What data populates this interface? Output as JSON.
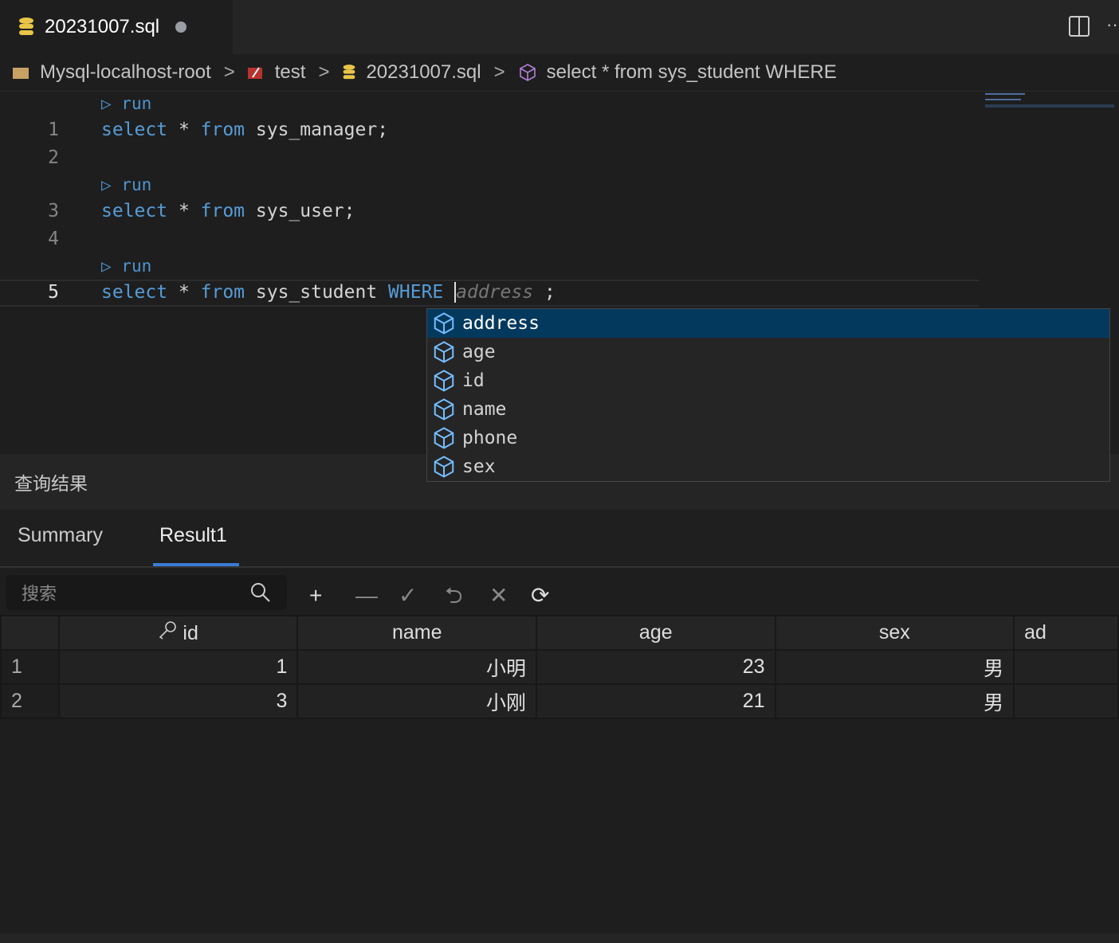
{
  "tab": {
    "title": "20231007.sql",
    "icon": "database-icon",
    "modified": true
  },
  "breadcrumb": [
    "Mysql-localhost-root",
    "test",
    "20231007.sql",
    "select * from sys_student WHERE"
  ],
  "editor": {
    "run_label": "run",
    "lines": [
      {
        "num": "1",
        "kw1": "select",
        "op": " * ",
        "kw2": "from",
        "rest": " sys_manager;",
        "run": true
      },
      {
        "num": "2",
        "run": false
      },
      {
        "num": "3",
        "kw1": "select",
        "op": " * ",
        "kw2": "from",
        "rest": " sys_user;",
        "run": true
      },
      {
        "num": "4",
        "run": false
      },
      {
        "num": "5",
        "kw1": "select",
        "op": " * ",
        "kw2": "from",
        "rest": " sys_student ",
        "kw3": "WHERE",
        "ghost": "address",
        "tail": " ;",
        "run": true
      }
    ]
  },
  "suggestions": [
    "address",
    "age",
    "id",
    "name",
    "phone",
    "sex"
  ],
  "panel": {
    "title": "查询结果",
    "tabs": [
      "Summary",
      "Result1"
    ],
    "active_tab": "Result1",
    "search_placeholder": "搜索",
    "accent": "#3a7bd5"
  },
  "table": {
    "columns": [
      "id",
      "name",
      "age",
      "sex",
      "ad"
    ],
    "rows": [
      [
        "1",
        "1",
        "小明",
        "23",
        "男",
        ""
      ],
      [
        "2",
        "3",
        "小刚",
        "21",
        "男",
        ""
      ]
    ]
  }
}
